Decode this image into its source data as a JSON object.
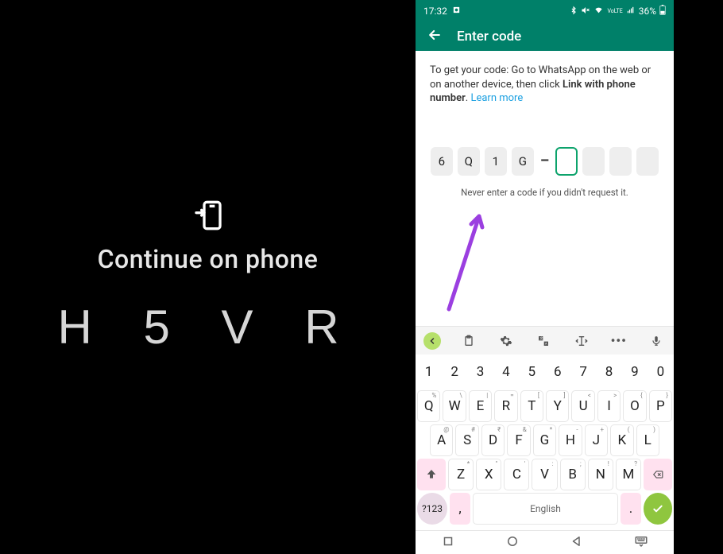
{
  "left": {
    "title": "Continue on phone",
    "code": "H 5 V R"
  },
  "phone": {
    "status": {
      "time": "17:32",
      "battery": "36%"
    },
    "topbar": {
      "title": "Enter code"
    },
    "instructions": {
      "pre": "To get your code: Go to WhatsApp on the web or on another device, then click ",
      "bold": "Link with phone number",
      "post": ". ",
      "link": "Learn more"
    },
    "code_cells": [
      "6",
      "Q",
      "1",
      "G"
    ],
    "code_note": "Never enter a code if you didn't request it.",
    "keyboard": {
      "row_num": [
        "1",
        "2",
        "3",
        "4",
        "5",
        "6",
        "7",
        "8",
        "9",
        "0"
      ],
      "row_q": [
        {
          "main": "Q",
          "sup": "%"
        },
        {
          "main": "W",
          "sup": "\\"
        },
        {
          "main": "E",
          "sup": "|"
        },
        {
          "main": "R",
          "sup": "="
        },
        {
          "main": "T",
          "sup": "["
        },
        {
          "main": "Y",
          "sup": "]"
        },
        {
          "main": "U",
          "sup": "<"
        },
        {
          "main": "I",
          "sup": ">"
        },
        {
          "main": "O",
          "sup": "{"
        },
        {
          "main": "P",
          "sup": "}"
        }
      ],
      "row_a": [
        {
          "main": "A",
          "sup": "@"
        },
        {
          "main": "S",
          "sup": "#"
        },
        {
          "main": "D",
          "sup": "₹"
        },
        {
          "main": "F",
          "sup": "&"
        },
        {
          "main": "G",
          "sup": "*"
        },
        {
          "main": "H",
          "sup": "-"
        },
        {
          "main": "J",
          "sup": "+"
        },
        {
          "main": "K",
          "sup": "("
        },
        {
          "main": "L",
          "sup": ")"
        }
      ],
      "row_z": [
        {
          "main": "Z",
          "sup": "*"
        },
        {
          "main": "X",
          "sup": "\""
        },
        {
          "main": "C",
          "sup": "'"
        },
        {
          "main": "V",
          "sup": ":"
        },
        {
          "main": "B",
          "sup": ";"
        },
        {
          "main": "N",
          "sup": "!"
        },
        {
          "main": "M",
          "sup": "?"
        }
      ],
      "mode": "?123",
      "comma": ",",
      "space": "English",
      "dot": ".",
      "enter": "✓"
    }
  }
}
